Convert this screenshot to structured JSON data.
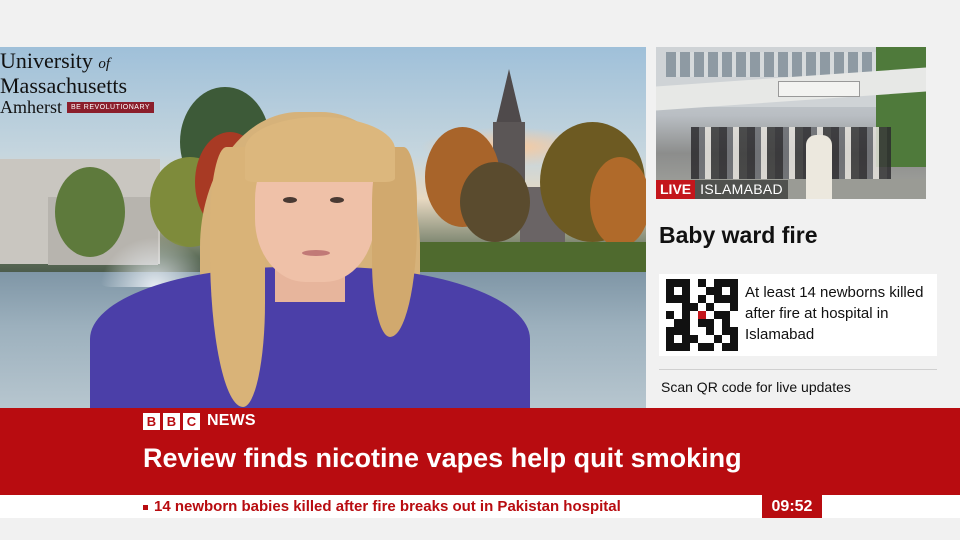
{
  "main_video": {
    "logo": {
      "line1": "University",
      "line1_of": "of",
      "line2": "Massachusetts",
      "line3": "Amherst",
      "tagline": "BE REVOLUTIONARY"
    }
  },
  "side_panel": {
    "live_label": "LIVE",
    "location": "ISLAMABAD",
    "heading": "Baby ward fire",
    "qr_caption": "At least 14 newborns killed after fire at hospital in Islamabad",
    "scan_prompt": "Scan QR code for live updates"
  },
  "banner": {
    "brand_letters": [
      "B",
      "B",
      "C"
    ],
    "brand_news": "NEWS",
    "headline": "Review finds nicotine vapes help quit smoking",
    "ticker": "14 newborn babies killed after fire breaks out in Pakistan hospital",
    "clock": "09:52"
  },
  "colors": {
    "bbc_red": "#b80c10",
    "live_red": "#c4161c",
    "umass_maroon": "#8b1e2b"
  }
}
